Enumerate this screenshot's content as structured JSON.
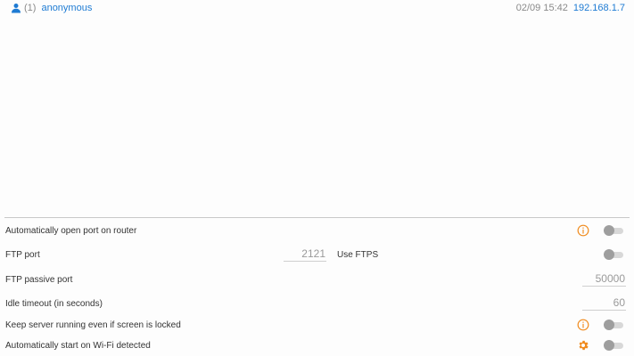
{
  "status": {
    "user_count": "(1)",
    "user_name": "anonymous",
    "datetime": "02/09 15:42",
    "ip_address": "192.168.1.7"
  },
  "settings": {
    "auto_open_port": {
      "label": "Automatically open port on router",
      "enabled": false
    },
    "ftp_port": {
      "label": "FTP port",
      "value": "2121",
      "use_ftps_label": "Use FTPS",
      "use_ftps_enabled": false
    },
    "ftp_passive_port": {
      "label": "FTP passive port",
      "value": "50000"
    },
    "idle_timeout": {
      "label": "Idle timeout (in seconds)",
      "value": "60"
    },
    "keep_running": {
      "label": "Keep server running even if screen is locked",
      "enabled": false
    },
    "auto_start_wifi": {
      "label": "Automatically start on Wi-Fi detected",
      "enabled": false
    }
  },
  "colors": {
    "accent_blue": "#1e7bd3",
    "accent_orange": "#f08a1c",
    "toggle_off": "#9e9e9e"
  }
}
